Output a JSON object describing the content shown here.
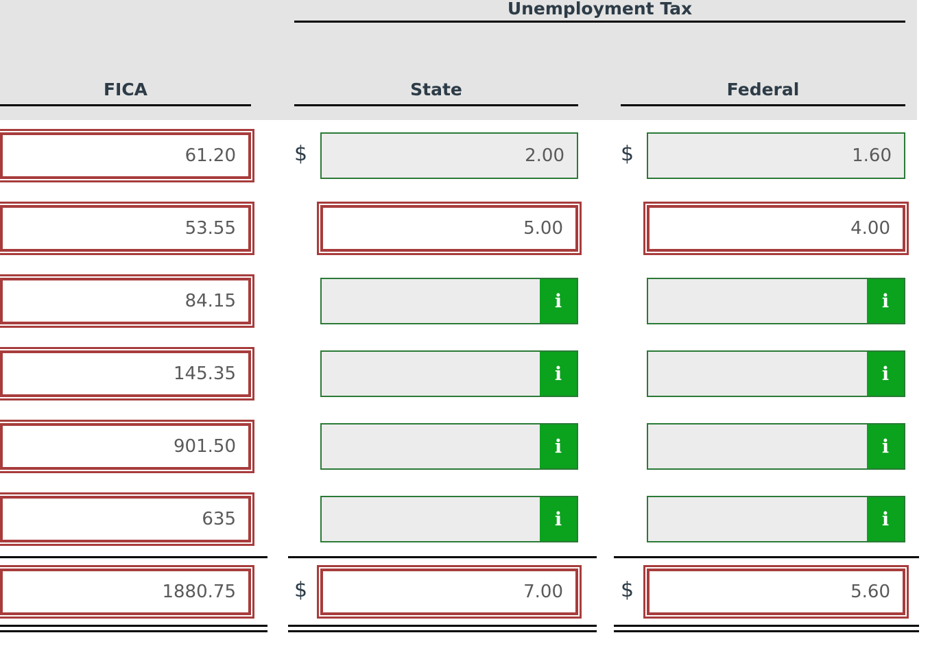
{
  "table": {
    "group_header": {
      "label": "Unemployment Tax",
      "spans": [
        "State",
        "Federal"
      ]
    },
    "columns": [
      {
        "key": "fica",
        "label": "FICA"
      },
      {
        "key": "state",
        "label": "State"
      },
      {
        "key": "federal",
        "label": "Federal"
      }
    ],
    "currency_symbol": "$",
    "info_icon": "i",
    "rows": [
      {
        "fica": {
          "value": "61.20",
          "state": "incorrect",
          "prefix": false
        },
        "state": {
          "value": "2.00",
          "state": "correct",
          "prefix": true
        },
        "federal": {
          "value": "1.60",
          "state": "correct",
          "prefix": true
        }
      },
      {
        "fica": {
          "value": "53.55",
          "state": "incorrect",
          "prefix": false
        },
        "state": {
          "value": "5.00",
          "state": "incorrect",
          "prefix": false
        },
        "federal": {
          "value": "4.00",
          "state": "incorrect",
          "prefix": false
        }
      },
      {
        "fica": {
          "value": "84.15",
          "state": "incorrect",
          "prefix": false
        },
        "state": {
          "value": "",
          "state": "correct",
          "prefix": false,
          "info": true
        },
        "federal": {
          "value": "",
          "state": "correct",
          "prefix": false,
          "info": true
        }
      },
      {
        "fica": {
          "value": "145.35",
          "state": "incorrect",
          "prefix": false
        },
        "state": {
          "value": "",
          "state": "correct",
          "prefix": false,
          "info": true
        },
        "federal": {
          "value": "",
          "state": "correct",
          "prefix": false,
          "info": true
        }
      },
      {
        "fica": {
          "value": "901.50",
          "state": "incorrect",
          "prefix": false
        },
        "state": {
          "value": "",
          "state": "correct",
          "prefix": false,
          "info": true
        },
        "federal": {
          "value": "",
          "state": "correct",
          "prefix": false,
          "info": true
        }
      },
      {
        "fica": {
          "value": "635",
          "state": "incorrect",
          "prefix": false
        },
        "state": {
          "value": "",
          "state": "correct",
          "prefix": false,
          "info": true
        },
        "federal": {
          "value": "",
          "state": "correct",
          "prefix": false,
          "info": true
        }
      }
    ],
    "totals": {
      "fica": {
        "value": "1880.75",
        "state": "incorrect",
        "prefix": false
      },
      "state": {
        "value": "7.00",
        "state": "incorrect",
        "prefix": true
      },
      "federal": {
        "value": "5.60",
        "state": "incorrect",
        "prefix": true
      }
    }
  },
  "colors": {
    "header_background": "#e4e4e4",
    "header_text": "#2d3c47",
    "rule": "#000000",
    "incorrect_border": "#a83c3c",
    "correct_border": "#2a7a36",
    "readonly_fill": "#ececec",
    "info_button": "#0ba21d",
    "value_text": "#5a5a5a"
  }
}
